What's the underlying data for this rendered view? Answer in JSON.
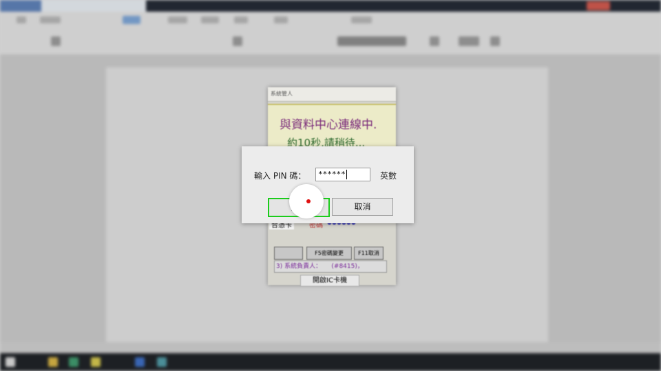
{
  "background_window": {
    "title": "系統管人",
    "message_line1": "與資料中心連線中.",
    "message_line2": "約10秒,請稍待...",
    "lower_left": "合憑卡",
    "password_label": "密碼",
    "password_mask": "●●●●●●",
    "f5_button": "F5密碼變更",
    "f11_button": "F11取消",
    "info_line": "3) 系統負責人：     (#8415)，",
    "ic_button": "開啟IC卡機"
  },
  "pin_dialog": {
    "label": "輸入 PIN 碼：",
    "value": "******",
    "unit_label": "英數",
    "ok_label": "確定",
    "cancel_label": "取消"
  },
  "colors": {
    "focus_outline": "#1bcc1b",
    "message_purple": "#7a2a7a",
    "message_green": "#2f6a2f",
    "cursor_marker": "#e01010"
  }
}
